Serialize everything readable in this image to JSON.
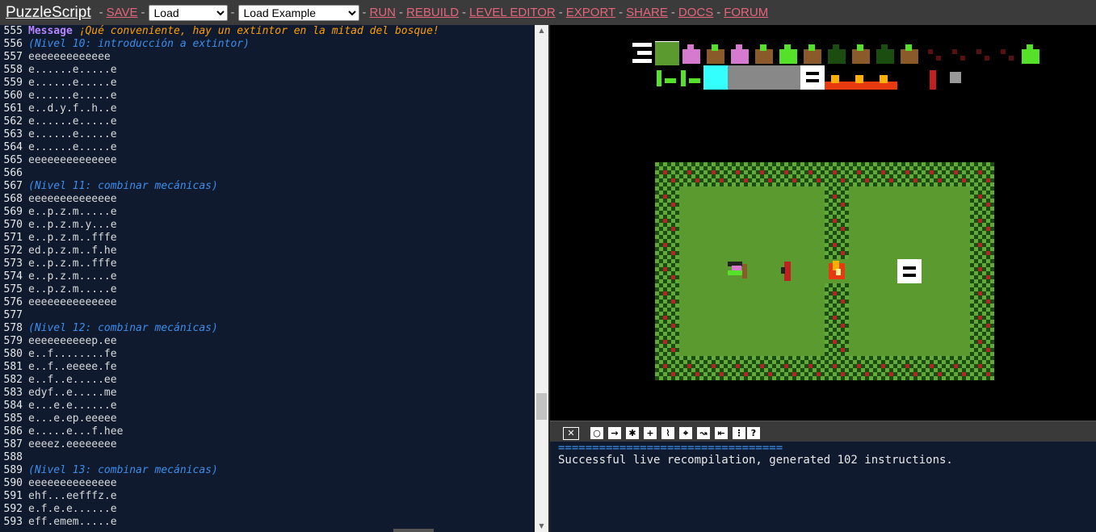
{
  "app": {
    "title": "PuzzleScript",
    "save_label": "SAVE",
    "load_select": "Load",
    "example_select": "Load Example",
    "run_label": "RUN",
    "rebuild_label": "REBUILD",
    "level_editor_label": "LEVEL EDITOR",
    "export_label": "EXPORT",
    "share_label": "SHARE",
    "docs_label": "DOCS",
    "forum_label": "FORUM",
    "separator": "-"
  },
  "editor": {
    "lines": [
      {
        "n": "555",
        "type": "message",
        "kw": "Message",
        "text": "¡Qué conveniente, hay un extintor en la mitad del bosque!"
      },
      {
        "n": "556",
        "type": "comment",
        "text": "(Nivel 10: introducción a extintor)"
      },
      {
        "n": "557",
        "type": "code",
        "text": "eeeeeeeeeeeee"
      },
      {
        "n": "558",
        "type": "code",
        "text": "e......e.....e"
      },
      {
        "n": "559",
        "type": "code",
        "text": "e......e.....e"
      },
      {
        "n": "560",
        "type": "code",
        "text": "e......e.....e"
      },
      {
        "n": "561",
        "type": "code",
        "text": "e..d.y.f..h..e"
      },
      {
        "n": "562",
        "type": "code",
        "text": "e......e.....e"
      },
      {
        "n": "563",
        "type": "code",
        "text": "e......e.....e"
      },
      {
        "n": "564",
        "type": "code",
        "text": "e......e.....e"
      },
      {
        "n": "565",
        "type": "code",
        "text": "eeeeeeeeeeeeee"
      },
      {
        "n": "566",
        "type": "code",
        "text": ""
      },
      {
        "n": "567",
        "type": "comment",
        "text": "(Nivel 11: combinar mecánicas)"
      },
      {
        "n": "568",
        "type": "code",
        "text": "eeeeeeeeeeeeee"
      },
      {
        "n": "569",
        "type": "code",
        "text": "e..p.z.m.....e"
      },
      {
        "n": "570",
        "type": "code",
        "text": "e..p.z.m.y...e"
      },
      {
        "n": "571",
        "type": "code",
        "text": "e..p.z.m..fffe"
      },
      {
        "n": "572",
        "type": "code",
        "text": "ed.p.z.m..f.he"
      },
      {
        "n": "573",
        "type": "code",
        "text": "e..p.z.m..fffe"
      },
      {
        "n": "574",
        "type": "code",
        "text": "e..p.z.m.....e"
      },
      {
        "n": "575",
        "type": "code",
        "text": "e..p.z.m.....e"
      },
      {
        "n": "576",
        "type": "code",
        "text": "eeeeeeeeeeeeee"
      },
      {
        "n": "577",
        "type": "code",
        "text": ""
      },
      {
        "n": "578",
        "type": "comment",
        "text": "(Nivel 12: combinar mecánicas)"
      },
      {
        "n": "579",
        "type": "code",
        "text": "eeeeeeeeeep.ee"
      },
      {
        "n": "580",
        "type": "code",
        "text": "e..f........fe"
      },
      {
        "n": "581",
        "type": "code",
        "text": "e..f..eeeee.fe"
      },
      {
        "n": "582",
        "type": "code",
        "text": "e..f..e.....ee"
      },
      {
        "n": "583",
        "type": "code",
        "text": "edyf..e.....me"
      },
      {
        "n": "584",
        "type": "code",
        "text": "e...e.e......e"
      },
      {
        "n": "585",
        "type": "code",
        "text": "e...e.ep.eeeee"
      },
      {
        "n": "586",
        "type": "code",
        "text": "e.....e...f.hee"
      },
      {
        "n": "587",
        "type": "code",
        "text": "eeeez.eeeeeeee"
      },
      {
        "n": "588",
        "type": "code",
        "text": ""
      },
      {
        "n": "589",
        "type": "comment",
        "text": "(Nivel 13: combinar mecánicas)"
      },
      {
        "n": "590",
        "type": "code",
        "text": "eeeeeeeeeeeeee"
      },
      {
        "n": "591",
        "type": "code",
        "text": "ehf...eefffz.e"
      },
      {
        "n": "592",
        "type": "code",
        "text": "e.f.e.e......e"
      },
      {
        "n": "593",
        "type": "code",
        "text": "eff.emem.....e"
      }
    ]
  },
  "toolbar_icons": [
    "close-icon",
    "action-icon",
    "right-arrow-icon",
    "random-icon",
    "add-icon",
    "squiggle-icon",
    "merge-icon",
    "wave-icon",
    "back-icon",
    "menu-icon",
    "help-icon"
  ],
  "toolbar_glyphs": [
    "✕",
    "○",
    "→",
    "✱",
    "+",
    "⌇",
    "⌖",
    "↝",
    "⇤",
    "⋮",
    "?"
  ],
  "console": {
    "rule": "=================================",
    "message": "Successful live recompilation, generated 102 instructions."
  },
  "colors": {
    "topbar_bg": "#3b3b3b",
    "link": "#e2667a",
    "editor_bg": "#0f1a2e",
    "comment": "#3d8de8",
    "keyword": "#b585ff",
    "message": "#ff9e00",
    "grass": "#5a9a2e",
    "bush_dark": "#1c4d10",
    "bush_light": "#63a83a",
    "berry": "#b02828"
  }
}
